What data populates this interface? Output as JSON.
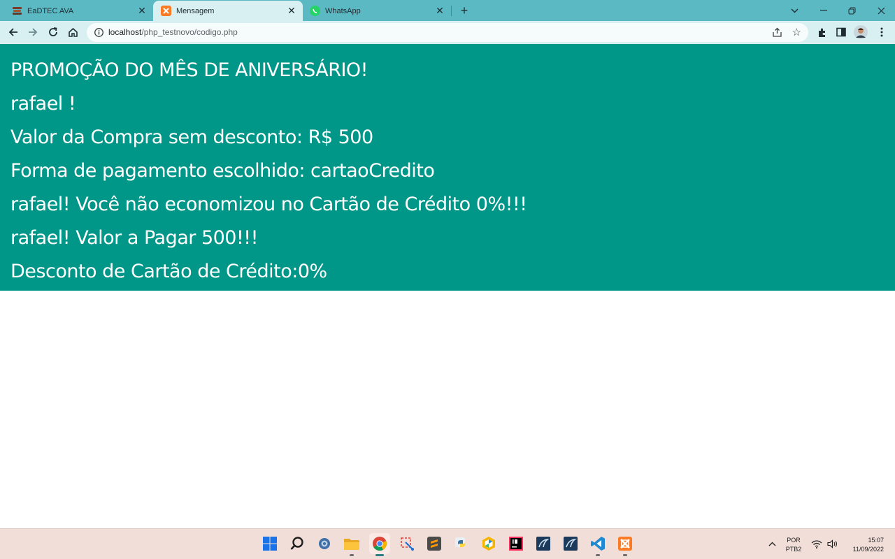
{
  "tabs": [
    {
      "title": "EaDTEC AVA",
      "icon": "book-stack-icon",
      "active": false
    },
    {
      "title": "Mensagem",
      "icon": "xampp-icon",
      "active": true
    },
    {
      "title": "WhatsApp",
      "icon": "whatsapp-icon",
      "active": false
    }
  ],
  "toolbar": {
    "url_host": "localhost",
    "url_path": "/php_testnovo/codigo.php"
  },
  "page": {
    "lines": [
      "PROMOÇÃO DO MÊS DE ANIVERSÁRIO!",
      "rafael !",
      "Valor da Compra sem desconto: R$ 500",
      "Forma de pagamento escolhido: cartaoCredito",
      "rafael! Você não economizou no Cartão de Crédito 0%!!!",
      "rafael! Valor a Pagar 500!!!",
      "Desconto de Cartão de Crédito:0%"
    ],
    "background_color": "#009688",
    "text_color": "#ffffff"
  },
  "taskbar": {
    "apps": [
      "windows-start-icon",
      "search-icon",
      "settings-icon",
      "file-explorer-icon",
      "chrome-icon",
      "snipping-tool-icon",
      "sublime-text-icon",
      "python-icon",
      "git-icon",
      "intellij-icon",
      "mysql-workbench-icon",
      "mysql-workbench-icon",
      "vscode-icon",
      "xampp-icon"
    ],
    "language_top": "POR",
    "language_bottom": "PTB2",
    "time": "15:07",
    "date": "11/09/2022"
  }
}
